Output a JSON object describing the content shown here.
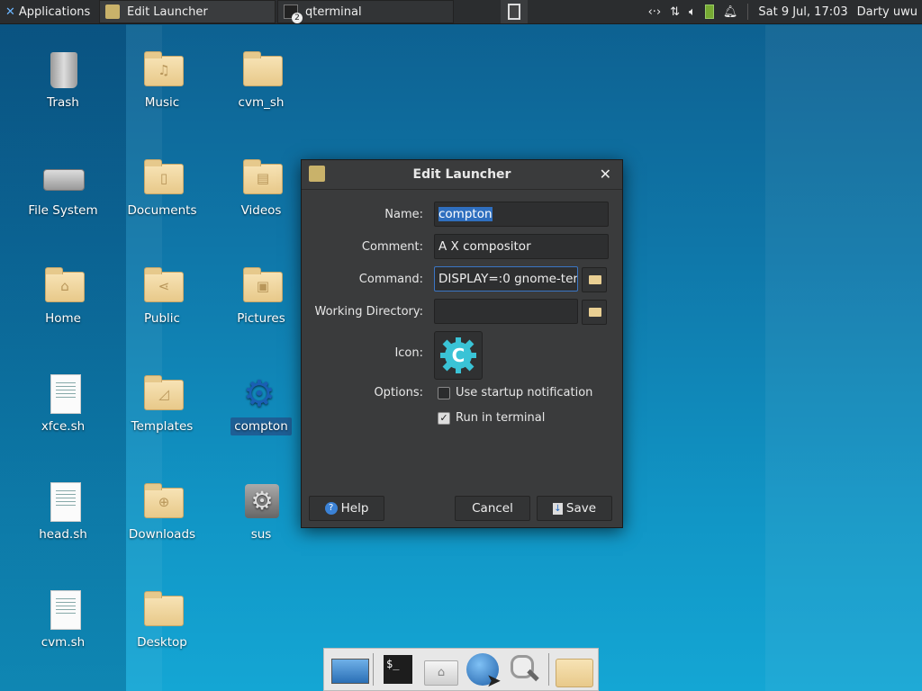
{
  "panel": {
    "apps_label": "Applications",
    "tasks": [
      {
        "label": "Edit Launcher"
      },
      {
        "label": "qterminal",
        "badge": "2"
      }
    ],
    "clock": "Sat  9 Jul, 17:03",
    "user": "Darty uwu",
    "tray_icons": [
      "network-icon",
      "updown-arrows-icon",
      "volume-icon",
      "battery-icon",
      "bell-icon"
    ]
  },
  "desktop": {
    "icons": [
      {
        "label": "Trash"
      },
      {
        "label": "Music"
      },
      {
        "label": "cvm_sh"
      },
      {
        "label": "File System"
      },
      {
        "label": "Documents"
      },
      {
        "label": "Videos"
      },
      {
        "label": "Home"
      },
      {
        "label": "Public"
      },
      {
        "label": "Pictures"
      },
      {
        "label": "xfce.sh"
      },
      {
        "label": "Templates"
      },
      {
        "label": "compton"
      },
      {
        "label": "head.sh"
      },
      {
        "label": "Downloads"
      },
      {
        "label": "sus"
      },
      {
        "label": "cvm.sh"
      },
      {
        "label": "Desktop"
      }
    ]
  },
  "dialog": {
    "title": "Edit Launcher",
    "name_label": "Name:",
    "name_value": "compton",
    "comment_label": "Comment:",
    "comment_value": "A X compositor",
    "command_label": "Command:",
    "command_value": "DISPLAY=:0 gnome-ter",
    "workdir_label": "Working Directory:",
    "workdir_value": "",
    "icon_label": "Icon:",
    "options_label": "Options:",
    "opt_startup": "Use startup notification",
    "opt_startup_checked": false,
    "opt_terminal": "Run in terminal",
    "opt_terminal_checked": true,
    "help": "Help",
    "cancel": "Cancel",
    "save": "Save"
  },
  "colors": {
    "accent": "#2f6fbf",
    "dialog_bg": "#3a3b3c",
    "panel_bg": "#2b2d2f"
  }
}
